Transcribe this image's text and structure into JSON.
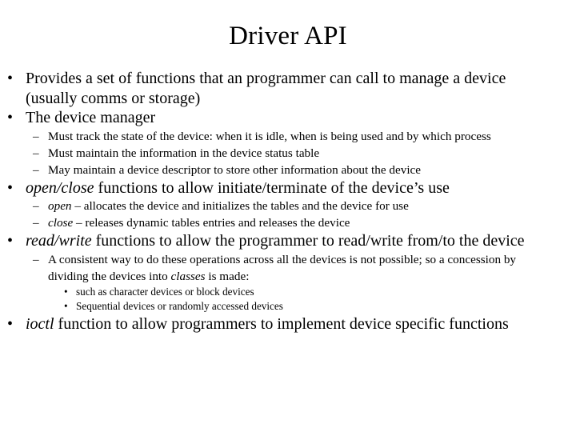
{
  "slide": {
    "title": "Driver API",
    "bullet_glyph_level1": "•",
    "bullet_glyph_level2": "–",
    "bullet_glyph_level3": "•",
    "content": [
      {
        "level": 1,
        "text": "Provides a set of functions that an programmer can call to manage a device (usually comms or storage)"
      },
      {
        "level": 1,
        "text": "The device manager"
      },
      {
        "level": 2,
        "text": "Must track the state of the device: when it is idle, when is being used and by which process"
      },
      {
        "level": 2,
        "text": "Must maintain the information in the device status table"
      },
      {
        "level": 2,
        "text": "May maintain a device descriptor to store other information about the device"
      },
      {
        "level": 1,
        "italic_lead": "open/close",
        "text": " functions to allow initiate/terminate of the device’s use"
      },
      {
        "level": 2,
        "italic_lead": "open",
        "text": " – allocates the device and initializes the tables and the device for use"
      },
      {
        "level": 2,
        "italic_lead": "close",
        "text": " – releases dynamic tables entries and releases the device"
      },
      {
        "level": 1,
        "italic_lead": "read/write",
        "text": " functions to allow the programmer to read/write from/to the device"
      },
      {
        "level": 2,
        "text_before_italic": "A consistent way to do these operations across all the devices is not possible; so a concession by dividing the devices into ",
        "italic_mid": "classes",
        "text_after_italic": " is made:"
      },
      {
        "level": 3,
        "text": "such as character devices or block devices"
      },
      {
        "level": 3,
        "text": "Sequential devices or randomly accessed devices"
      },
      {
        "level": 1,
        "italic_lead": "ioctl",
        "text": " function to allow programmers to implement device specific functions"
      }
    ]
  }
}
